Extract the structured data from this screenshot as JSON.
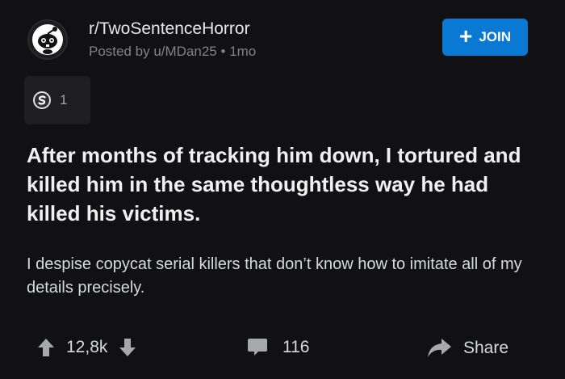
{
  "header": {
    "subreddit": "r/TwoSentenceHorror",
    "posted_by": "Posted by u/MDan25",
    "separator": "•",
    "age": "1mo",
    "join_label": "JOIN"
  },
  "award": {
    "count": "1"
  },
  "post": {
    "title": "After months of tracking him down, I tortured and killed him in the same thoughtless way he had killed his victims.",
    "body": "I despise copycat serial killers that don’t know how to imitate all of my details precisely."
  },
  "footer": {
    "votes": "12,8k",
    "comments": "116",
    "share_label": "Share"
  },
  "colors": {
    "background": "#111113",
    "join_button": "#0a79d3",
    "muted_text": "#818384",
    "icons": "#a6a8aa"
  },
  "icons": [
    "subreddit-avatar",
    "plus-icon",
    "award-icon",
    "upvote-icon",
    "downvote-icon",
    "comment-icon",
    "share-icon"
  ]
}
